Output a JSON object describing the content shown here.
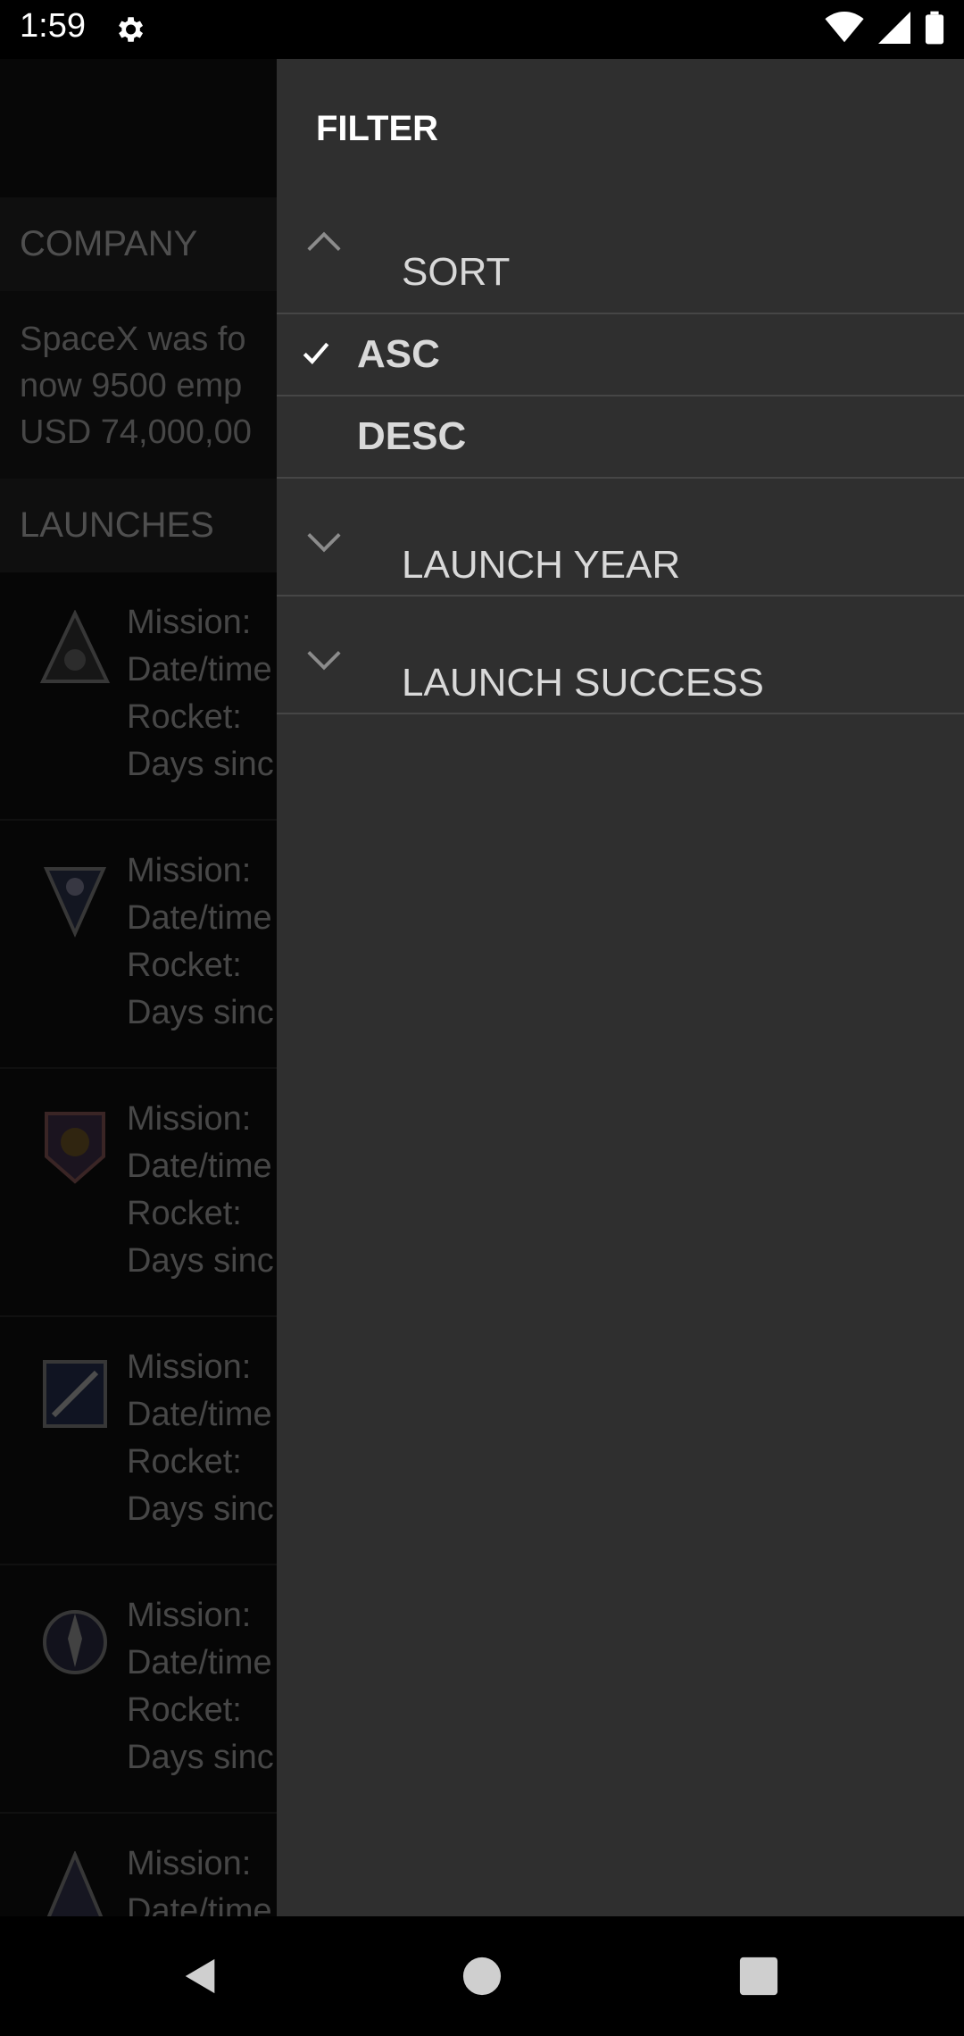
{
  "status_bar": {
    "time": "1:59"
  },
  "app": {
    "company_header": "COMPANY",
    "company_text_lines": [
      "SpaceX was fo",
      "now 9500 emp",
      "USD 74,000,00"
    ],
    "launches_header": "LAUNCHES",
    "launch_item_lines": [
      "Mission:",
      "Date/time",
      "Rocket:",
      "Days sinc"
    ]
  },
  "drawer": {
    "title": "FILTER",
    "sort_label": "SORT",
    "sort_options": [
      "ASC",
      "DESC"
    ],
    "selected_sort": "ASC",
    "launch_year_label": "LAUNCH YEAR",
    "launch_success_label": "LAUNCH SUCCESS"
  },
  "icons": {
    "status": [
      "gear-icon",
      "wifi-icon",
      "signal-icon",
      "battery-icon"
    ],
    "nav": [
      "back-icon",
      "home-icon",
      "recents-icon"
    ],
    "chevrons": [
      "chevron-up-icon",
      "chevron-down-icon",
      "chevron-down-icon"
    ]
  },
  "colors": {
    "drawer_bg": "#2f2f2f",
    "app_bg": "#121212",
    "divider": "#464646"
  }
}
